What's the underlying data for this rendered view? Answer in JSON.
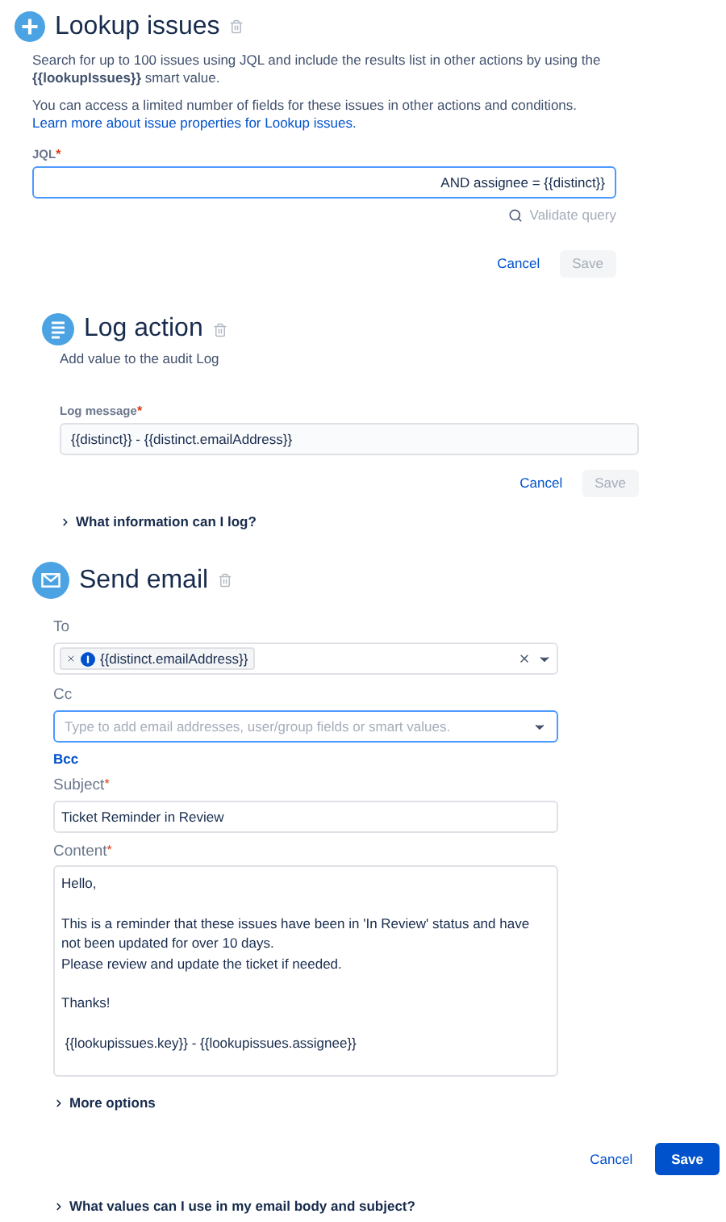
{
  "lookup": {
    "title": "Lookup issues",
    "description": "Search for up to 100 issues using JQL and include the results list in other actions by using the **{{lookupIssues}}** smart value.",
    "note": "You can access a limited number of fields for these issues in other actions and conditions.",
    "note_link": [
      "Learn more",
      "about issue properties for Lookup issues."
    ],
    "jql": {
      "label": "JQL",
      "required_mark": "*",
      "value": "AND assignee = {{distinct}}",
      "focused": true
    },
    "validate": "Validate query",
    "cancel": "Cancel",
    "save": {
      "label": "Save",
      "disabled": true
    }
  },
  "log": {
    "title": "Log action",
    "description": "Add value to the audit Log",
    "message": {
      "label": "Log message",
      "required_mark": "*",
      "value": "{{distinct}} - {{distinct.emailAddress}}",
      "focused": false
    },
    "cancel": "Cancel",
    "save": {
      "label": "Save",
      "disabled": true
    },
    "expander": {
      "label": "What information can I log?",
      "expanded": false
    }
  },
  "email": {
    "title": "Send email",
    "to": {
      "label": "To",
      "recipients": [
        "{{distinct.emailAddress}}"
      ]
    },
    "cc": {
      "label": "Cc",
      "placeholder": "Type to add email addresses, user/group fields or smart values.",
      "focused": true
    },
    "bcc": "Bcc",
    "subject": {
      "label": "Subject",
      "required_mark": "*",
      "value": "Ticket Reminder in Review",
      "focused": false
    },
    "content": {
      "label": "Content",
      "required_mark": "*",
      "value": "Hello,\n\nThis is a reminder that these issues have been in 'In Review' status and have not been updated for over 10 days.\nPlease review and update the ticket if needed.\n\nThanks!\n\n {{lookupissues.key}} - {{lookupissues.assignee}}"
    },
    "more_options": {
      "label": "More options",
      "expanded": false
    },
    "cancel": "Cancel",
    "save": {
      "label": "Save",
      "disabled": false
    },
    "expander": {
      "label": "What values can I use in my email body and subject?",
      "expanded": false
    }
  }
}
